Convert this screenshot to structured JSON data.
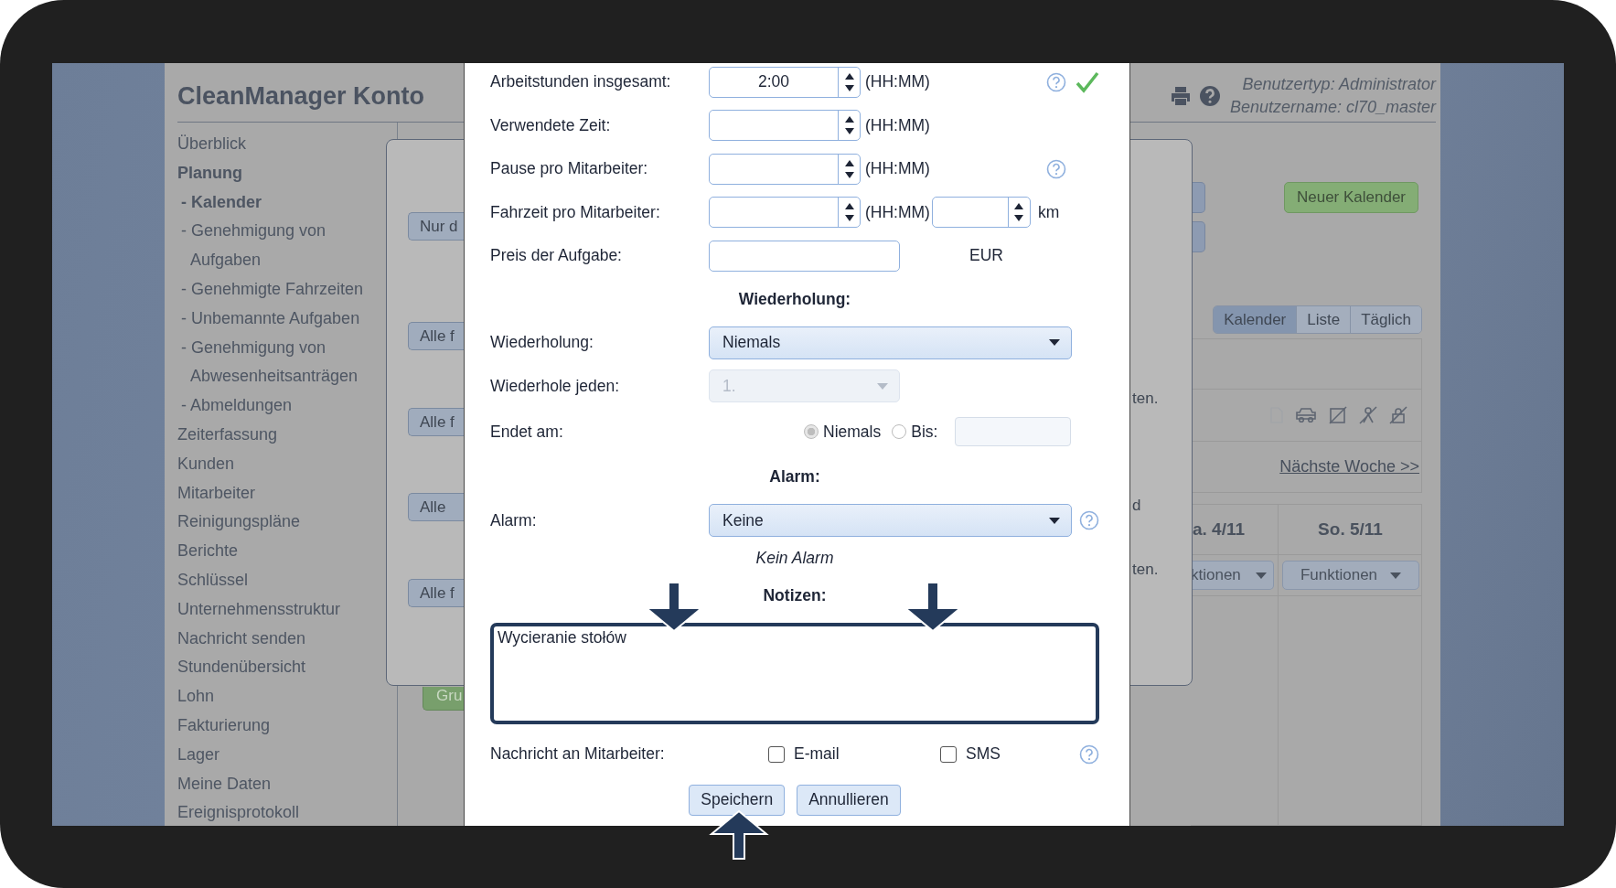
{
  "header": {
    "title": "CleanManager Konto",
    "user_type": "Benutzertyp: Administrator",
    "user_name": "Benutzername: cl70_master"
  },
  "sidebar": {
    "items": [
      {
        "label": "Überblick",
        "selected": false
      },
      {
        "label": "Planung",
        "selected": true,
        "children": [
          {
            "label": "- Kalender",
            "selected": true
          },
          {
            "label": "- Genehmigung von Aufgaben",
            "selected": false
          },
          {
            "label": "- Genehmigte Fahrzeiten",
            "selected": false
          },
          {
            "label": "- Unbemannte Aufgaben",
            "selected": false
          },
          {
            "label": "- Genehmigung von Abwesenheitsanträgen",
            "selected": false
          },
          {
            "label": "- Abmeldungen",
            "selected": false
          }
        ]
      },
      {
        "label": "Zeiterfassung",
        "selected": false
      },
      {
        "label": "Kunden",
        "selected": false
      },
      {
        "label": "Mitarbeiter",
        "selected": false
      },
      {
        "label": "Reinigungspläne",
        "selected": false
      },
      {
        "label": "Berichte",
        "selected": false
      },
      {
        "label": "Schlüssel",
        "selected": false
      },
      {
        "label": "Unternehmensstruktur",
        "selected": false
      },
      {
        "label": "Nachricht senden",
        "selected": false
      },
      {
        "label": "Stundenübersicht",
        "selected": false
      },
      {
        "label": "Lohn",
        "selected": false
      },
      {
        "label": "Fakturierung",
        "selected": false
      },
      {
        "label": "Lager",
        "selected": false
      },
      {
        "label": "Meine Daten",
        "selected": false
      },
      {
        "label": "Ereignisprotokoll",
        "selected": false
      }
    ]
  },
  "background": {
    "dialog_buttons": [
      "Nur d",
      "Alle f",
      "Alle f",
      "Alle",
      "Alle f"
    ],
    "dialog_texts": [
      "ten.",
      "d",
      "ten."
    ],
    "group_button": "Gru"
  },
  "calendar": {
    "new_button": "Neuer Kalender",
    "tabs": [
      {
        "label": "Kalender",
        "selected": true
      },
      {
        "label": "Liste",
        "selected": false
      },
      {
        "label": "Täglich",
        "selected": false
      }
    ],
    "next_link": "Nächste Woche >>",
    "days": [
      {
        "label": "a. 4/11",
        "menu": "ktionen"
      },
      {
        "label": "So. 5/11",
        "menu": "Funktionen"
      }
    ]
  },
  "modal": {
    "rows": [
      {
        "kind": "spin",
        "label": "Arbeitstunden insgesamt:",
        "value": "2:00",
        "unit": "(HH:MM)",
        "help": true,
        "valid": true
      },
      {
        "kind": "spin",
        "label": "Verwendete Zeit:",
        "unit": "(HH:MM)",
        "help": false,
        "valid": false
      },
      {
        "kind": "spin",
        "label": "Pause pro Mitarbeiter:",
        "unit": "(HH:MM)",
        "help": true,
        "valid": false
      },
      {
        "kind": "spin2",
        "label": "Fahrzeit pro Mitarbeiter:",
        "unit": "(HH:MM)",
        "unit2": "km"
      },
      {
        "kind": "text",
        "label": "Preis der Aufgabe:",
        "unit": "EUR"
      },
      {
        "kind": "heading",
        "label": "Wiederholung:"
      },
      {
        "kind": "select",
        "label": "Wiederholung:",
        "value": "Niemals",
        "disabled": false,
        "help": false
      },
      {
        "kind": "select_short",
        "label": "Wiederhole jeden:",
        "value": "1.",
        "disabled": true
      },
      {
        "kind": "ends",
        "label": "Endet am:",
        "options": [
          {
            "label": "Niemals",
            "selected": true
          },
          {
            "label": "Bis:",
            "selected": false
          }
        ]
      },
      {
        "kind": "heading",
        "label": "Alarm:"
      },
      {
        "kind": "select",
        "label": "Alarm:",
        "value": "Keine",
        "disabled": false,
        "help": true
      },
      {
        "kind": "note",
        "label": "Kein Alarm"
      },
      {
        "kind": "heading",
        "label": "Notizen:"
      },
      {
        "kind": "textarea",
        "value": "Wycieranie stołów"
      },
      {
        "kind": "checks",
        "label": "Nachricht an Mitarbeiter:",
        "options": [
          {
            "label": "E-mail",
            "checked": false
          },
          {
            "label": "SMS",
            "checked": false
          }
        ],
        "help": true
      }
    ],
    "buttons": [
      "Speichern",
      "Annullieren"
    ]
  }
}
